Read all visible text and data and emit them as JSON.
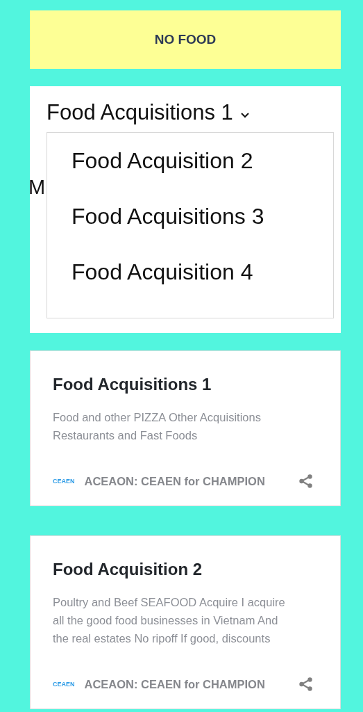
{
  "banner": {
    "label": "NO FOOD"
  },
  "menu": {
    "label": "Food Acquisitions 1",
    "expanded": true,
    "hidden_text": "M",
    "options": [
      {
        "label": "Food Acquisition 2"
      },
      {
        "label": "Food Acquisitions 3"
      },
      {
        "label": "Food Acquisition 4"
      }
    ]
  },
  "posts": [
    {
      "title": "Food Acquisitions 1",
      "snippet": "Food and other PIZZA Other Acquisitions Restaurants and Fast Foods",
      "badge": "CEAEN",
      "author": "ACEAON: CEAEN for CHAMPION"
    },
    {
      "title": "Food Acquisition 2",
      "snippet": "Poultry and Beef SEAFOOD Acquire I acquire all the good food businesses in Vietnam And the real estates No ripoff  If good, discounts",
      "badge": "CEAEN",
      "author": "ACEAON: CEAEN for CHAMPION"
    }
  ]
}
